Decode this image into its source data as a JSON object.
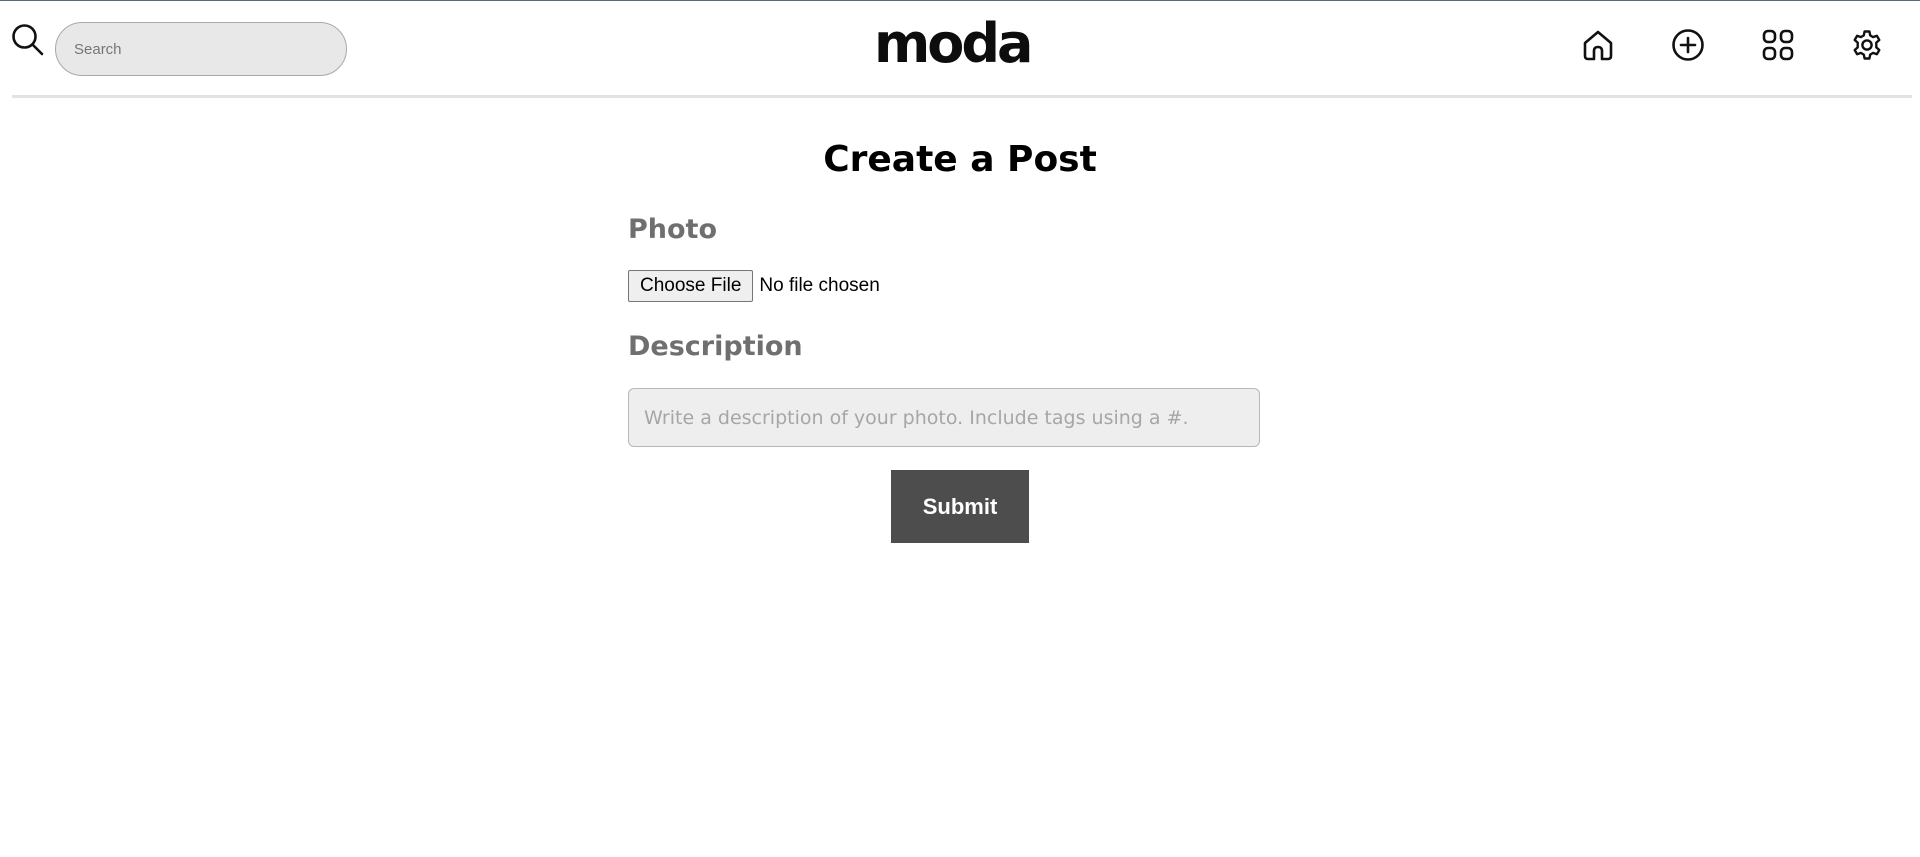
{
  "header": {
    "search": {
      "placeholder": "Search",
      "value": "",
      "icon": "search-icon"
    },
    "logo": "moda",
    "nav": [
      {
        "name": "home",
        "icon": "home-icon"
      },
      {
        "name": "create",
        "icon": "plus-circle-icon"
      },
      {
        "name": "gallery",
        "icon": "grid-icon"
      },
      {
        "name": "settings",
        "icon": "gear-icon"
      }
    ]
  },
  "main": {
    "title": "Create a Post",
    "photo_label": "Photo",
    "file_button_label": "Choose File",
    "file_status": "No file chosen",
    "description_label": "Description",
    "description_placeholder": "Write a description of your photo. Include tags using a #.",
    "description_value": "",
    "submit_label": "Submit"
  },
  "colors": {
    "submit_bg": "#4d4d4d",
    "label_text": "#6f6f6f",
    "input_bg": "#eeeeee"
  }
}
